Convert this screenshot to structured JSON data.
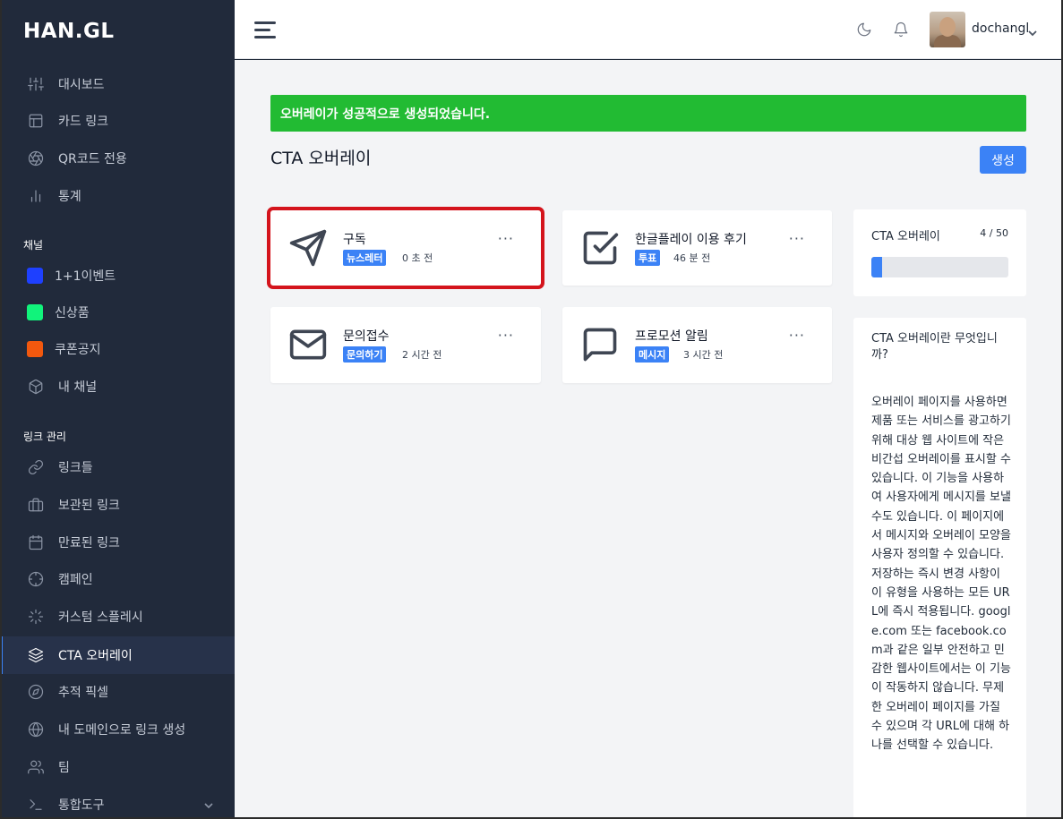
{
  "brand": {
    "logo": "HAN.GL"
  },
  "sidebar": {
    "main": [
      {
        "label": "대시보드",
        "icon": "sliders-icon"
      },
      {
        "label": "카드 링크",
        "icon": "layout-icon"
      },
      {
        "label": "QR코드 전용",
        "icon": "aperture-icon"
      },
      {
        "label": "통계",
        "icon": "bar-chart-icon"
      }
    ],
    "channels_heading": "채널",
    "channels": [
      {
        "label": "1+1이벤트",
        "color": "#1e40ff"
      },
      {
        "label": "신상품",
        "color": "#11f37b"
      },
      {
        "label": "쿠폰공지",
        "color": "#f2580e"
      },
      {
        "label": "내 채널",
        "icon": "box-icon"
      }
    ],
    "links_heading": "링크 관리",
    "links": [
      {
        "label": "링크들",
        "icon": "link-icon"
      },
      {
        "label": "보관된 링크",
        "icon": "briefcase-icon"
      },
      {
        "label": "만료된 링크",
        "icon": "calendar-icon"
      },
      {
        "label": "캠페인",
        "icon": "crosshair-icon"
      },
      {
        "label": "커스텀 스플레시",
        "icon": "loader-icon"
      },
      {
        "label": "CTA 오버레이",
        "icon": "layers-icon"
      },
      {
        "label": "추적 픽셀",
        "icon": "compass-icon"
      },
      {
        "label": "내 도메인으로 링크 생성",
        "icon": "globe-icon"
      },
      {
        "label": "팀",
        "icon": "users-icon"
      },
      {
        "label": "통합도구",
        "icon": "terminal-icon"
      }
    ]
  },
  "header": {
    "username": "dochangl"
  },
  "main": {
    "alert": "오버레이가 성공적으로 생성되었습니다.",
    "title": "CTA 오버레이",
    "create_button": "생성",
    "cards": [
      {
        "title": "구독",
        "badge": "뉴스레터",
        "time": "0 초 전",
        "icon": "send-icon"
      },
      {
        "title": "한글플레이 이용 후기",
        "badge": "투표",
        "time": "46 분 전",
        "icon": "check-square-icon"
      },
      {
        "title": "문의접수",
        "badge": "문의하기",
        "time": "2 시간 전",
        "icon": "mail-icon"
      },
      {
        "title": "프로모션 알림",
        "badge": "메시지",
        "time": "3 시간 전",
        "icon": "message-square-icon"
      }
    ],
    "more": "···",
    "stats": {
      "title": "CTA 오버레이",
      "count": "4 / 50",
      "progress": 0.08
    },
    "info": {
      "title": "CTA 오버레이란 무엇입니까?",
      "body": "오버레이 페이지를 사용하면 제품 또는 서비스를 광고하기 위해 대상 웹 사이트에 작은 비간섭 오버레이를 표시할 수 있습니다. 이 기능을 사용하여 사용자에게 메시지를 보낼 수도 있습니다. 이 페이지에서 메시지와 오버레이 모양을 사용자 정의할 수 있습니다. 저장하는 즉시 변경 사항이 이 유형을 사용하는 모든 URL에 즉시 적용됩니다. google.com 또는 facebook.com과 같은 일부 안전하고 민감한 웹사이트에서는 이 기능이 작동하지 않습니다. 무제한 오버레이 페이지를 가질 수 있으며 각 URL에 대해 하나를 선택할 수 있습니다."
    }
  }
}
